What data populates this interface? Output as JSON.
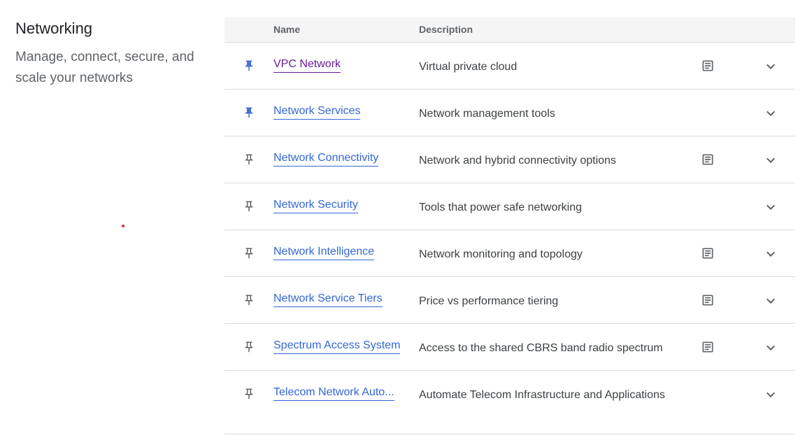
{
  "section": {
    "title": "Networking",
    "subtitle": "Manage, connect, secure, and scale your networks"
  },
  "table": {
    "headers": {
      "name": "Name",
      "description": "Description"
    },
    "rows": [
      {
        "name": "VPC Network",
        "description": "Virtual private cloud",
        "pinned": true,
        "visited": true,
        "docs": true,
        "icon": "pin-icon"
      },
      {
        "name": "Network Services",
        "description": "Network management tools",
        "pinned": true,
        "visited": false,
        "docs": false,
        "icon": "pin-icon"
      },
      {
        "name": "Network Connectivity",
        "description": "Network and hybrid connectivity options",
        "pinned": false,
        "visited": false,
        "docs": true,
        "icon": "pin-outline-icon"
      },
      {
        "name": "Network Security",
        "description": "Tools that power safe networking",
        "pinned": false,
        "visited": false,
        "docs": false,
        "icon": "pin-outline-icon"
      },
      {
        "name": "Network Intelligence",
        "description": "Network monitoring and topology",
        "pinned": false,
        "visited": false,
        "docs": true,
        "icon": "pin-outline-icon"
      },
      {
        "name": "Network Service Tiers",
        "description": "Price vs performance tiering",
        "pinned": false,
        "visited": false,
        "docs": true,
        "icon": "pin-outline-icon"
      },
      {
        "name": "Spectrum Access System",
        "description": "Access to the shared CBRS band radio spectrum",
        "pinned": false,
        "visited": false,
        "docs": true,
        "icon": "pin-outline-icon"
      },
      {
        "name": "Telecom Network Auto...",
        "description": "Automate Telecom Infrastructure and Applications",
        "pinned": false,
        "visited": false,
        "docs": false,
        "icon": "pin-outline-icon"
      }
    ]
  },
  "colors": {
    "link": "#3367d6",
    "visited_link": "#6a1b9a",
    "pin_active": "#4a6fd6",
    "icon_gray": "#5f6368"
  }
}
